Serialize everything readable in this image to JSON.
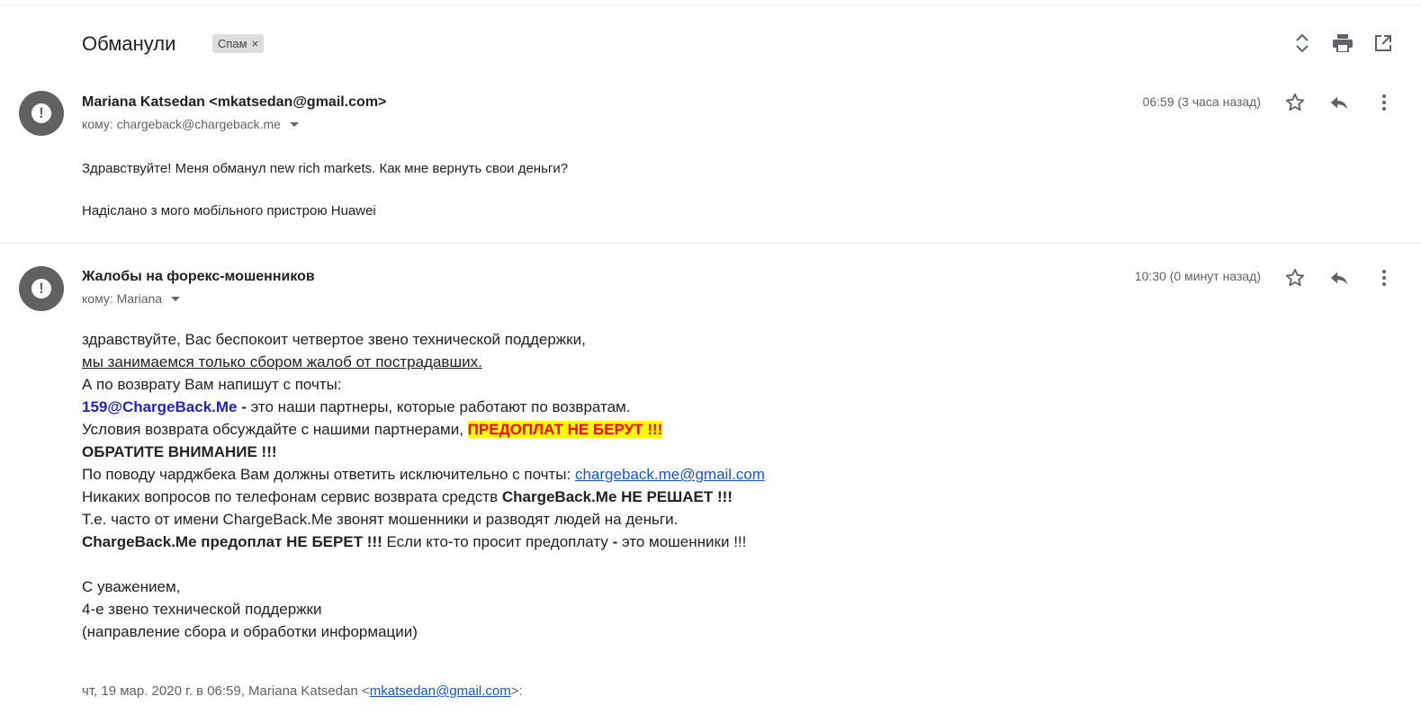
{
  "thread": {
    "subject": "Обманули",
    "label": "Спам",
    "label_remove": "×",
    "icons": [
      "expand-collapse-icon",
      "print-icon",
      "open-new-window-icon"
    ]
  },
  "message1": {
    "sender": "Mariana Katsedan <mkatsedan@gmail.com>",
    "to": "кому: chargeback@chargeback.me",
    "time": "06:59 (3 часа назад)",
    "body": [
      "Здравствуйте! Меня обманул  new rich markets. Как мне вернуть свои деньги?",
      "Надіслано з мого мобільного пристрою Huawei"
    ]
  },
  "message2": {
    "sender": "Жалобы на форекс-мошенников",
    "to": "кому: Mariana",
    "time": "10:30 (0 минут назад)",
    "lines": {
      "l1": "здравствуйте, Вас беспокоит четвертое звено технической поддержки,",
      "l2": "мы занимаемся только сбором жалоб от пострадавших.",
      "l3": "А по возврату Вам напишут с почты:",
      "l4_email": "159@ChargeBack.Me",
      "l4_dash": " - ",
      "l4_rest": "это наши партнеры, которые работают по возвратам.",
      "l5_text": "Условия возврата обсуждайте с нашими партнерами, ",
      "l5_highlight": "ПРЕДОПЛАТ НЕ БЕРУТ !!!",
      "l6": "ОБРАТИТЕ ВНИМАНИЕ !!!",
      "l7_text": "По поводу чарджбека Вам должны ответить исключительно с почты: ",
      "l7_link": "chargeback.me@gmail.com",
      "l8_text": "Никаких вопросов по телефонам сервис возврата средств ",
      "l8_bold": "ChargeBack.Me НЕ РЕШАЕТ !!!",
      "l9": "Т.е. часто от имени ChargeBack.Me звонят мошенники и разводят людей на деньги.",
      "l10_bold": "ChargeBack.Me предоплат НЕ БЕРЕТ !!!",
      "l10_text": " Если кто-то просит предоплату ",
      "l10_dash": "-",
      "l10_rest": " это мошенники !!!",
      "l11": "С уважением,",
      "l12": "4-е звено технической поддержки",
      "l13": "(направление сбора и обработки информации)"
    },
    "quote_prefix": "чт, 19 мар. 2020 г. в 06:59, Mariana Katsedan <",
    "quote_email": "mkatsedan@gmail.com",
    "quote_suffix": ">:"
  }
}
